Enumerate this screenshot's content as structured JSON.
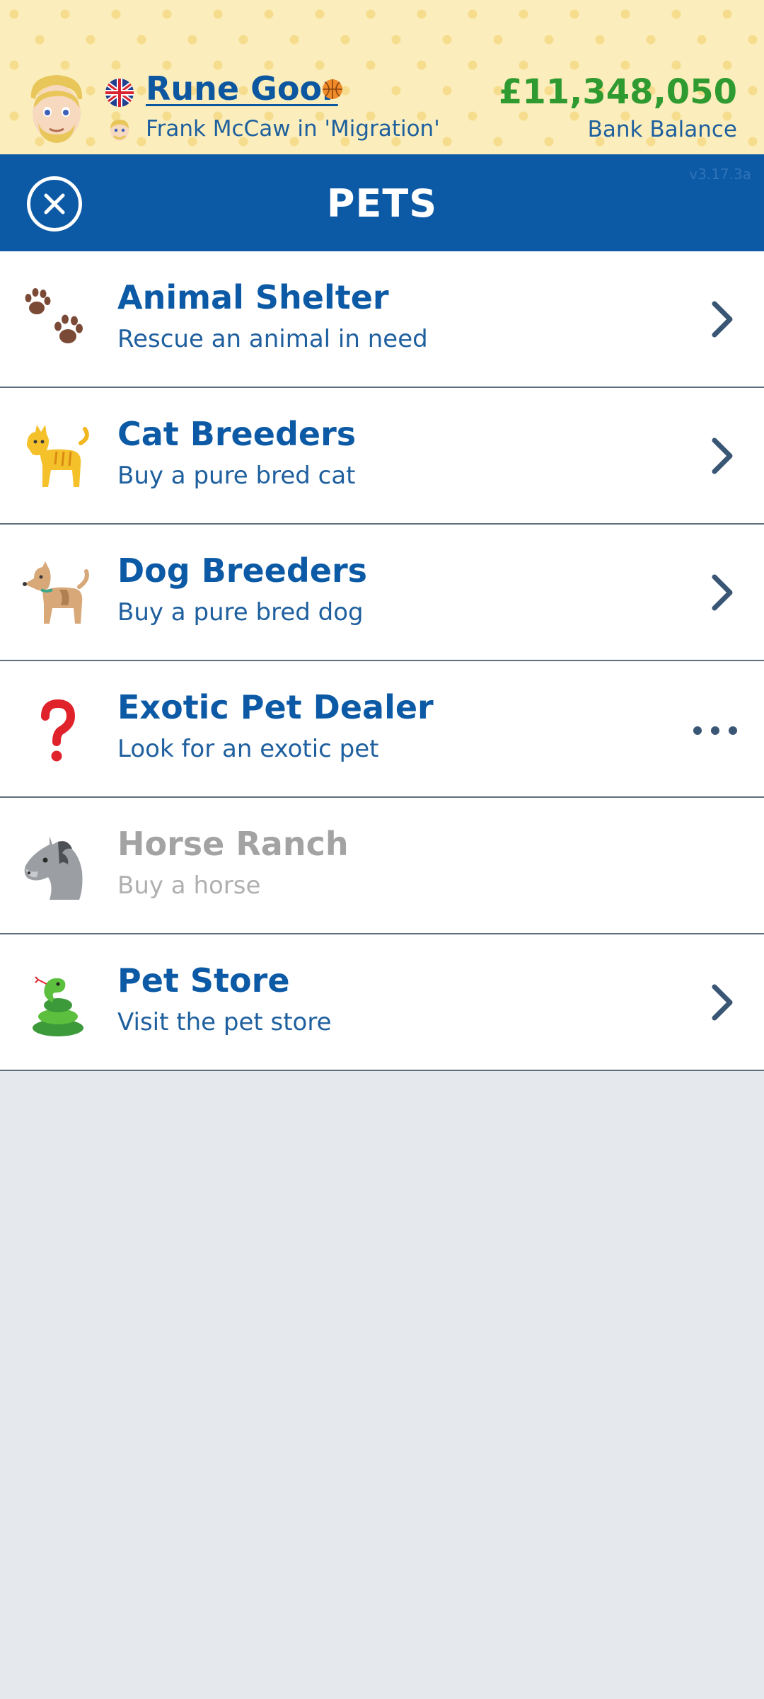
{
  "player": {
    "name": "Rune Goor",
    "occupation": "Frank McCaw in 'Migration'"
  },
  "bank": {
    "balance": "£11,348,050",
    "label": "Bank Balance"
  },
  "title_bar": {
    "title": "PETS",
    "version": "v3.17.3a",
    "close_icon": "close-icon"
  },
  "items": [
    {
      "title": "Animal Shelter",
      "subtitle": "Rescue an animal in need",
      "icon": "paw-prints-icon",
      "action": "chevron",
      "enabled": true
    },
    {
      "title": "Cat Breeders",
      "subtitle": "Buy a pure bred cat",
      "icon": "cat-icon",
      "action": "chevron",
      "enabled": true
    },
    {
      "title": "Dog Breeders",
      "subtitle": "Buy a pure bred dog",
      "icon": "dog-icon",
      "action": "chevron",
      "enabled": true
    },
    {
      "title": "Exotic Pet Dealer",
      "subtitle": "Look for an exotic pet",
      "icon": "question-mark-icon",
      "action": "more",
      "enabled": true
    },
    {
      "title": "Horse Ranch",
      "subtitle": "Buy a horse",
      "icon": "horse-icon",
      "action": "none",
      "enabled": false
    },
    {
      "title": "Pet Store",
      "subtitle": "Visit the pet store",
      "icon": "snake-icon",
      "action": "chevron",
      "enabled": true
    }
  ],
  "colors": {
    "header_bg": "#fbeebc",
    "title_bar": "#0c5aa5",
    "accent_blue": "#0c5aa5",
    "balance_green": "#2f9a2f",
    "disabled_gray": "#a3a3a3",
    "page_bg": "#e5e9ed"
  }
}
